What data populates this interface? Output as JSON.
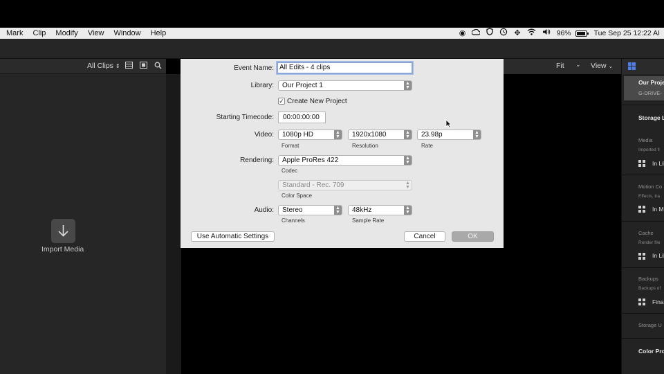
{
  "menubar": {
    "menus": [
      "Mark",
      "Clip",
      "Modify",
      "View",
      "Window",
      "Help"
    ],
    "status_icons": [
      "record-icon",
      "creative-cloud-icon",
      "shield-icon",
      "time-machine-icon",
      "move-icon",
      "wifi-icon",
      "volume-icon"
    ],
    "battery_text": "96%",
    "battery_level": 0.96,
    "clock": "Tue Sep 25  12:22 AI"
  },
  "browser": {
    "filter_label": "All Clips",
    "import_label": "Import Media"
  },
  "viewer": {
    "zoom_label": "Fit",
    "view_label": "View"
  },
  "inspector": {
    "library_name": "Our Proje",
    "library_drive": "G-DRIVE-",
    "storage_heading": "Storage L",
    "sections": [
      {
        "title": "Media",
        "subtitle": "Imported fi",
        "value": "In Lib"
      },
      {
        "title": "Motion Co",
        "subtitle": "Effects, tra",
        "value": "In M"
      },
      {
        "title": "Cache",
        "subtitle": "Render file",
        "value": "In Lib"
      },
      {
        "title": "Backups",
        "subtitle": "Backups of",
        "value": "Fina"
      }
    ],
    "storage_used": "Storage U",
    "color_heading": "Color Pro"
  },
  "dialog": {
    "event_name_label": "Event Name:",
    "event_name_value": "All Edits - 4 clips",
    "library_label": "Library:",
    "library_value": "Our Project 1",
    "create_project_label": "Create New Project",
    "create_project_checked": true,
    "timecode_label": "Starting Timecode:",
    "timecode_value": "00:00:00:00",
    "video_label": "Video:",
    "format_value": "1080p HD",
    "format_caption": "Format",
    "resolution_value": "1920x1080",
    "resolution_caption": "Resolution",
    "rate_value": "23.98p",
    "rate_caption": "Rate",
    "rendering_label": "Rendering:",
    "codec_value": "Apple ProRes 422",
    "codec_caption": "Codec",
    "colorspace_value": "Standard - Rec. 709",
    "colorspace_caption": "Color Space",
    "audio_label": "Audio:",
    "channels_value": "Stereo",
    "channels_caption": "Channels",
    "samplerate_value": "48kHz",
    "samplerate_caption": "Sample Rate",
    "auto_settings_button": "Use Automatic Settings",
    "cancel_button": "Cancel",
    "ok_button": "OK"
  }
}
